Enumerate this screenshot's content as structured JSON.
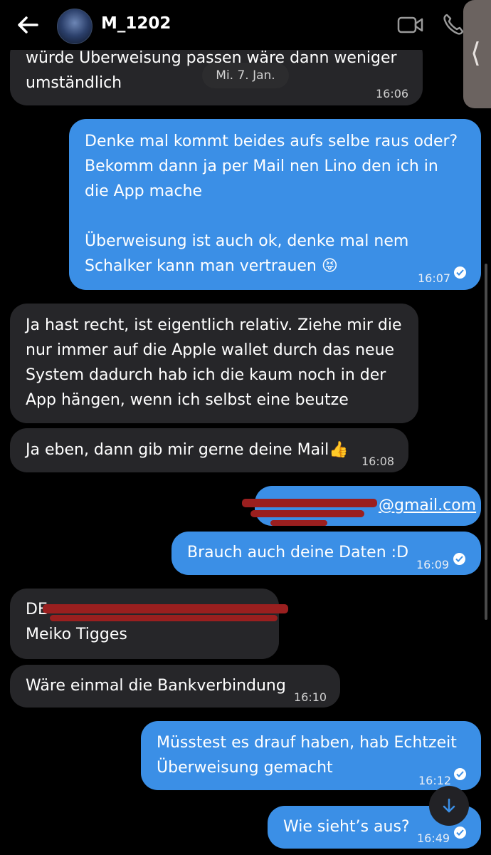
{
  "header": {
    "username": "M_1202",
    "back_icon": "arrow-left-icon",
    "video_icon": "video-call-icon",
    "phone_icon": "phone-icon"
  },
  "date_separator": "Mi. 7. Jan.",
  "side_tab": {
    "glyph": "⟨"
  },
  "messages": [
    {
      "dir": "in",
      "text": "würde Überweisung passen wäre dann weniger umständlich",
      "time": "16:06"
    },
    {
      "dir": "out",
      "text": "Denke mal kommt beides aufs selbe raus oder? Bekomm dann ja per Mail nen Lino den ich in die App mache",
      "text2": "Überweisung ist auch ok, denke mal nem Schalker kann man vertrauen",
      "emoji": "😝",
      "time": "16:07"
    },
    {
      "dir": "in",
      "text": "Ja hast recht, ist eigentlich relativ. Ziehe mir die nur immer auf die Apple wallet durch das neue System dadurch hab ich die kaum noch in der App hängen, wenn ich selbst eine beutze"
    },
    {
      "dir": "in",
      "text": "Ja eben, dann gib mir gerne deine Mail",
      "emoji": "👍",
      "time": "16:08"
    },
    {
      "dir": "out",
      "text": "@gmail.com",
      "redacted": true
    },
    {
      "dir": "out",
      "text": "Brauch auch deine Daten :D",
      "time": "16:09"
    },
    {
      "dir": "in",
      "text": "DE",
      "text2": "Meiko Tigges",
      "redacted": true
    },
    {
      "dir": "in",
      "text": "Wäre einmal die Bankverbindung",
      "time": "16:10"
    },
    {
      "dir": "out",
      "text": "Müsstest es drauf haben, hab Echtzeit Überweisung gemacht",
      "time": "16:12"
    },
    {
      "dir": "out",
      "text": "Wie sieht’s aus?",
      "time": "16:49"
    }
  ],
  "scroll_down_icon": "arrow-down-icon",
  "colors": {
    "outgoing": "#3b8fe6",
    "incoming": "#262629",
    "background": "#000000",
    "redaction": "#9a1f1f"
  }
}
